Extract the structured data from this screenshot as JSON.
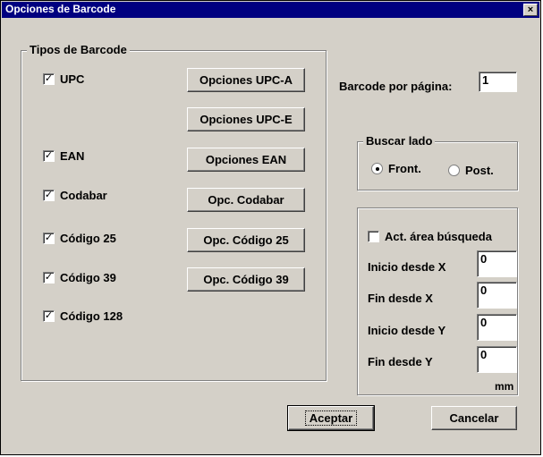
{
  "window": {
    "title": "Opciones de Barcode",
    "close_symbol": "×"
  },
  "barcode_types": {
    "legend": "Tipos de Barcode",
    "items": [
      {
        "label": "UPC",
        "checked": true
      },
      {
        "label": "EAN",
        "checked": true
      },
      {
        "label": "Codabar",
        "checked": true
      },
      {
        "label": "Código 25",
        "checked": true
      },
      {
        "label": "Código 39",
        "checked": true
      },
      {
        "label": "Código 128",
        "checked": true
      }
    ],
    "buttons": {
      "upca": "Opciones UPC-A",
      "upce": "Opciones UPC-E",
      "ean": "Opciones EAN",
      "codabar": "Opc. Codabar",
      "c25": "Opc. Código 25",
      "c39": "Opc. Código 39"
    }
  },
  "per_page": {
    "label": "Barcode por página:",
    "value": "1"
  },
  "search_side": {
    "legend": "Buscar lado",
    "options": [
      {
        "label": "Front.",
        "selected": true
      },
      {
        "label": "Post.",
        "selected": false
      }
    ]
  },
  "search_area": {
    "enable_label": "Act. área búsqueda",
    "enabled": false,
    "fields": {
      "start_x": {
        "label": "Inicio desde X",
        "value": "0"
      },
      "end_x": {
        "label": "Fin desde X",
        "value": "0"
      },
      "start_y": {
        "label": "Inicio desde Y",
        "value": "0"
      },
      "end_y": {
        "label": "Fin desde Y",
        "value": "0"
      }
    },
    "unit": "mm"
  },
  "footer": {
    "ok_label": "Aceptar",
    "cancel_label": "Cancelar"
  }
}
